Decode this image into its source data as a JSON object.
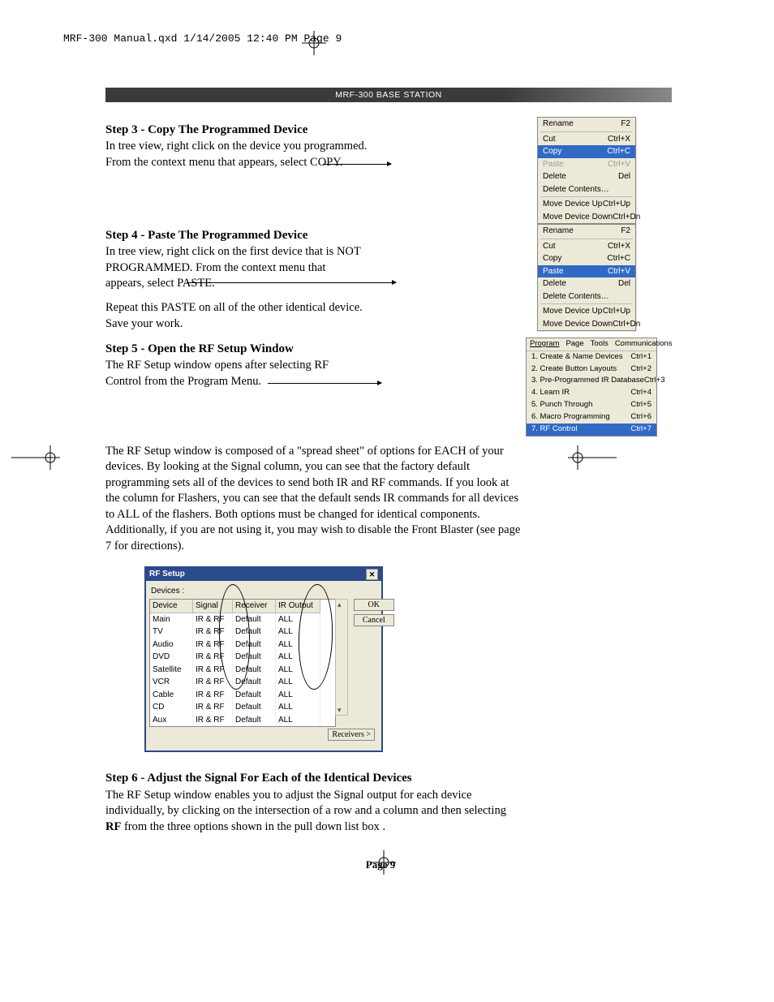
{
  "header_info": "MRF-300 Manual.qxd  1/14/2005  12:40 PM  Page 9",
  "title_bar": "MRF-300 BASE STATION",
  "step3": {
    "heading": "Step 3 - Copy The Programmed Device",
    "body": "In tree view, right click on the device you programmed. From the context menu that appears, select COPY."
  },
  "step4": {
    "heading": "Step 4 - Paste The Programmed Device",
    "body": "In tree view, right click on the first device that is NOT PROGRAMMED. From the context menu that appears, select PASTE.",
    "body2": "Repeat this PASTE on all of the other identical device. Save your work."
  },
  "step5": {
    "heading": "Step 5 - Open the RF Setup Window",
    "body": "The RF Setup window opens after selecting RF Control from the Program Menu.",
    "para": "The RF Setup window is composed of a \"spread sheet\" of options for EACH of your devices.  By looking at the Signal column, you can see that the factory default programming sets all of the devices to send both IR and RF commands. If you look at the column for Flashers, you can see that the default sends IR commands for all devices to ALL of the flashers. Both options must be changed for identical components. Additionally, if you are not using it, you may wish to disable the Front Blaster (see page 7 for directions)."
  },
  "step6": {
    "heading": "Step 6 - Adjust the Signal For Each of the Identical Devices",
    "body_a": "The RF Setup window enables you to adjust the Signal output for each device individually, by clicking on the intersection of a row and a column and then selecting ",
    "body_b": "RF",
    "body_c": " from the three options shown in the pull down list box ."
  },
  "ctx_menu": {
    "rename": "Rename",
    "rename_k": "F2",
    "cut": "Cut",
    "cut_k": "Ctrl+X",
    "copy": "Copy",
    "copy_k": "Ctrl+C",
    "paste": "Paste",
    "paste_k": "Ctrl+V",
    "delete": "Delete",
    "delete_k": "Del",
    "del_contents": "Delete Contents…",
    "mv_up": "Move Device Up",
    "mv_up_k": "Ctrl+Up",
    "mv_dn": "Move Device Down",
    "mv_dn_k": "Ctrl+Dn"
  },
  "prog_menu": {
    "bar": {
      "program": "Program",
      "page": "Page",
      "tools": "Tools",
      "comm": "Communications"
    },
    "i1": "1. Create & Name Devices",
    "k1": "Ctrl+1",
    "i2": "2. Create Button Layouts",
    "k2": "Ctrl+2",
    "i3": "3. Pre-Programmed IR Database",
    "k3": "Ctrl+3",
    "i4": "4. Learn IR",
    "k4": "Ctrl+4",
    "i5": "5. Punch Through",
    "k5": "Ctrl+5",
    "i6": "6. Macro Programming",
    "k6": "Ctrl+6",
    "i7": "7. RF Control",
    "k7": "Ctrl+7"
  },
  "rfsetup": {
    "title": "RF Setup",
    "devices_label": "Devices :",
    "cols": {
      "device": "Device",
      "signal": "Signal",
      "receiver": "Receiver",
      "irout": "IR Output"
    },
    "rows": [
      {
        "d": "Main",
        "s": "IR & RF",
        "r": "Default",
        "o": "ALL"
      },
      {
        "d": "TV",
        "s": "IR & RF",
        "r": "Default",
        "o": "ALL"
      },
      {
        "d": "Audio",
        "s": "IR & RF",
        "r": "Default",
        "o": "ALL"
      },
      {
        "d": "DVD",
        "s": "IR & RF",
        "r": "Default",
        "o": "ALL"
      },
      {
        "d": "Satellite",
        "s": "IR & RF",
        "r": "Default",
        "o": "ALL"
      },
      {
        "d": "VCR",
        "s": "IR & RF",
        "r": "Default",
        "o": "ALL"
      },
      {
        "d": "Cable",
        "s": "IR & RF",
        "r": "Default",
        "o": "ALL"
      },
      {
        "d": "CD",
        "s": "IR & RF",
        "r": "Default",
        "o": "ALL"
      },
      {
        "d": "Aux",
        "s": "IR & RF",
        "r": "Default",
        "o": "ALL"
      }
    ],
    "ok": "OK",
    "cancel": "Cancel",
    "receivers": "Receivers >"
  },
  "footer": "Page 9"
}
